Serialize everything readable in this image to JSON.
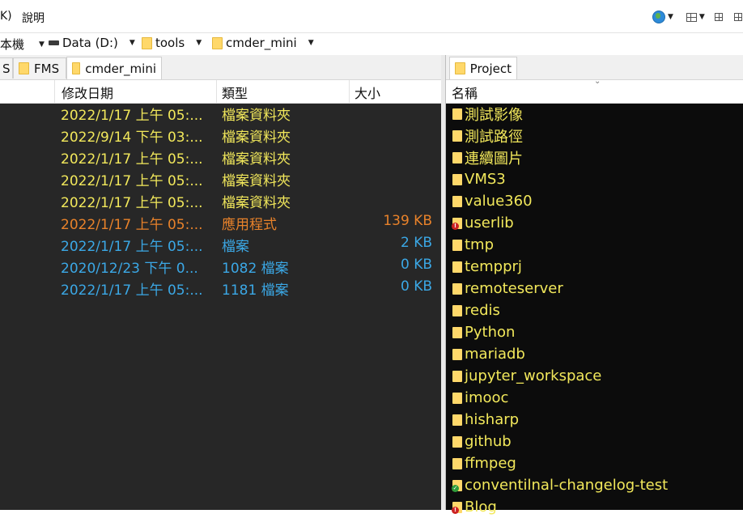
{
  "menu": {
    "items": [
      "K)",
      "說明"
    ]
  },
  "address": {
    "crumbs": [
      {
        "label": "本機",
        "icon": "none"
      },
      {
        "label": "Data (D:)",
        "icon": "drive-icon"
      },
      {
        "label": "tools",
        "icon": "folder-icon"
      },
      {
        "label": "cmder_mini",
        "icon": "folder-icon"
      }
    ]
  },
  "left": {
    "tabs": [
      {
        "label": "S"
      },
      {
        "label": "FMS"
      },
      {
        "label": "cmder_mini"
      }
    ],
    "columns": {
      "date": "修改日期",
      "type": "類型",
      "size": "大小"
    },
    "rows": [
      {
        "date": "2022/1/17 上午 05:...",
        "type": "檔案資料夾",
        "size": "",
        "color": "#f2e85b"
      },
      {
        "date": "2022/9/14 下午 03:...",
        "type": "檔案資料夾",
        "size": "",
        "color": "#f2e85b"
      },
      {
        "date": "2022/1/17 上午 05:...",
        "type": "檔案資料夾",
        "size": "",
        "color": "#f2e85b"
      },
      {
        "date": "2022/1/17 上午 05:...",
        "type": "檔案資料夾",
        "size": "",
        "color": "#f2e85b"
      },
      {
        "date": "2022/1/17 上午 05:...",
        "type": "檔案資料夾",
        "size": "",
        "color": "#f2e85b"
      },
      {
        "date": "2022/1/17 上午 05:...",
        "type": "應用程式",
        "size": "139 KB",
        "color": "#e8822a"
      },
      {
        "date": "2022/1/17 上午 05:...",
        "type": "檔案",
        "size": "2 KB",
        "color": "#3ba8e6"
      },
      {
        "date": "2020/12/23 下午 0...",
        "type": "1082 檔案",
        "size": "0 KB",
        "color": "#3ba8e6"
      },
      {
        "date": "2022/1/17 上午 05:...",
        "type": "1181 檔案",
        "size": "0 KB",
        "color": "#3ba8e6"
      }
    ]
  },
  "right": {
    "tab": {
      "label": "Project"
    },
    "column": {
      "name": "名稱"
    },
    "items": [
      {
        "name": "測試影像",
        "icon": "folder-icon"
      },
      {
        "name": "測試路徑",
        "icon": "folder-icon"
      },
      {
        "name": "連續圖片",
        "icon": "folder-icon"
      },
      {
        "name": "VMS3",
        "icon": "folder-icon"
      },
      {
        "name": "value360",
        "icon": "folder-icon"
      },
      {
        "name": "userlib",
        "icon": "folder-warning-icon"
      },
      {
        "name": "tmp",
        "icon": "folder-icon"
      },
      {
        "name": "tempprj",
        "icon": "folder-icon"
      },
      {
        "name": "remoteserver",
        "icon": "folder-icon"
      },
      {
        "name": "redis",
        "icon": "folder-icon"
      },
      {
        "name": "Python",
        "icon": "folder-icon"
      },
      {
        "name": "mariadb",
        "icon": "folder-icon"
      },
      {
        "name": "jupyter_workspace",
        "icon": "folder-icon"
      },
      {
        "name": "imooc",
        "icon": "folder-icon"
      },
      {
        "name": "hisharp",
        "icon": "folder-icon"
      },
      {
        "name": "github",
        "icon": "folder-icon"
      },
      {
        "name": "ffmpeg",
        "icon": "folder-icon"
      },
      {
        "name": "conventilnal-changelog-test",
        "icon": "folder-ok-icon"
      },
      {
        "name": "Blog",
        "icon": "folder-warning-icon"
      }
    ]
  },
  "toolbar_right": {
    "icons": [
      "globe-icon",
      "chevron-down-icon",
      "layout-grid-icon",
      "chevron-down-icon",
      "pane-icon",
      "pane-icon"
    ]
  }
}
